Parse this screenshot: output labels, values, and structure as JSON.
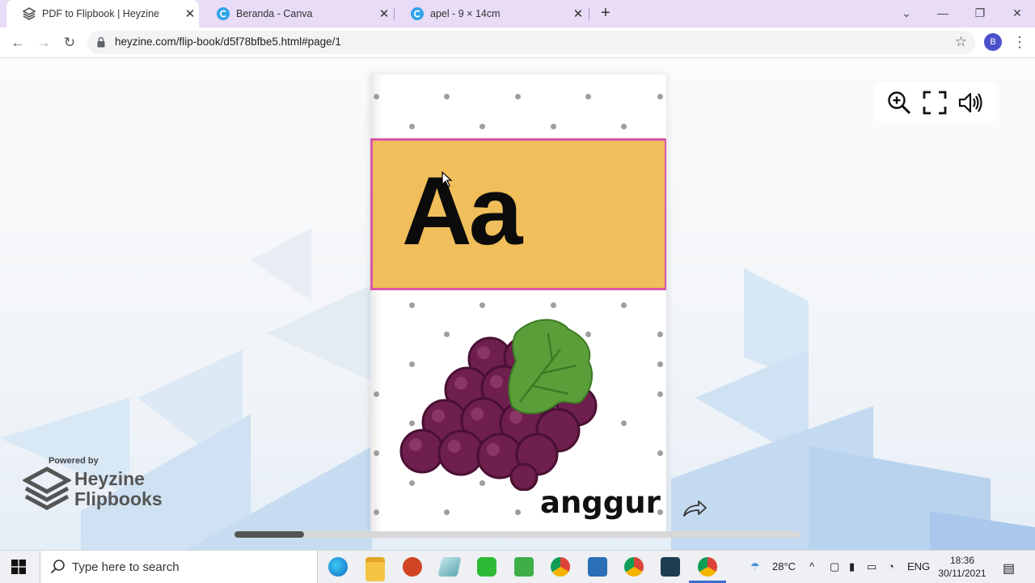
{
  "browser": {
    "tabs": [
      {
        "title": "PDF to Flipbook | Heyzine",
        "active": true
      },
      {
        "title": "Beranda - Canva",
        "active": false
      },
      {
        "title": "apel - 9 × 14cm",
        "active": false
      }
    ],
    "url": "heyzine.com/flip-book/d5f78bfbe5.html#page/1",
    "profile_initial": "B"
  },
  "flipbook": {
    "letter": "Aa",
    "word": "anggur",
    "scroll_position": 0.12,
    "powered_by": "Powered by",
    "brand_line1": "Heyzine",
    "brand_line2": "Flipbooks",
    "colors": {
      "card": "#f0be5a",
      "card_border": "#d858a8",
      "grape": "#6e1f4e",
      "leaf": "#5a9e3a"
    }
  },
  "taskbar": {
    "search_placeholder": "Type here to search",
    "weather": "28°C",
    "language": "ENG",
    "time": "18:36",
    "date": "30/11/2021"
  }
}
